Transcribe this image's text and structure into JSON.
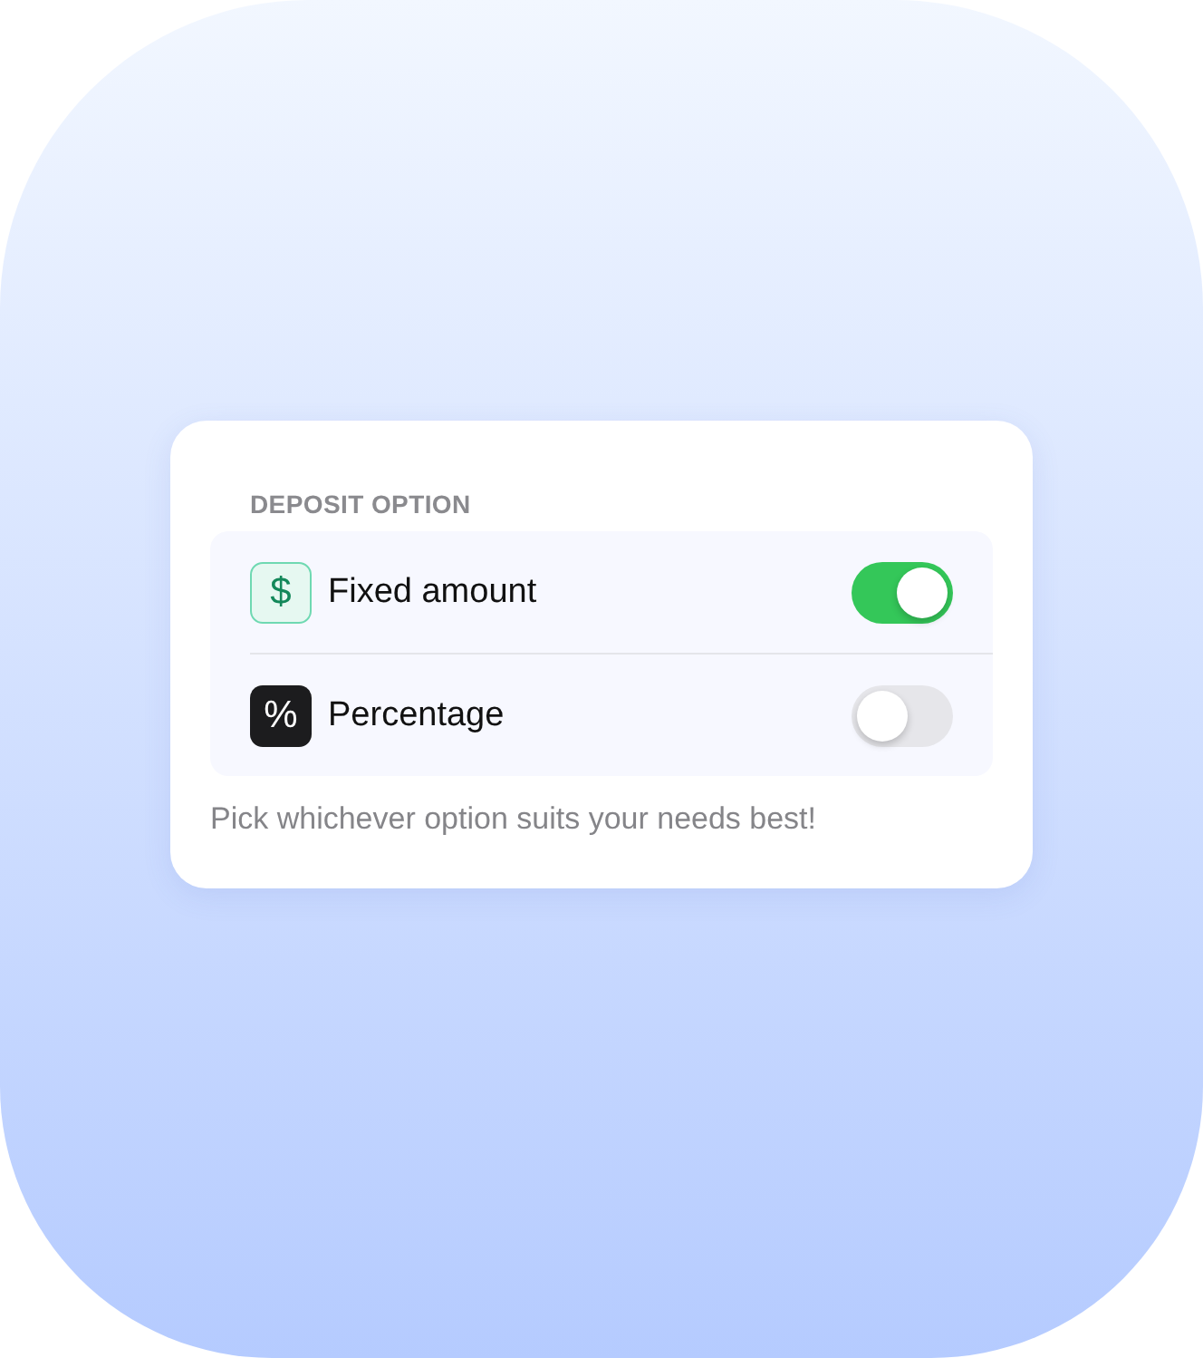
{
  "section_title": "DEPOSIT OPTION",
  "options": [
    {
      "kind": "money",
      "icon": "$",
      "label": "Fixed amount",
      "on": true
    },
    {
      "kind": "percent",
      "icon": "%",
      "label": "Percentage",
      "on": false
    }
  ],
  "footer": "Pick whichever option suits your needs best!"
}
